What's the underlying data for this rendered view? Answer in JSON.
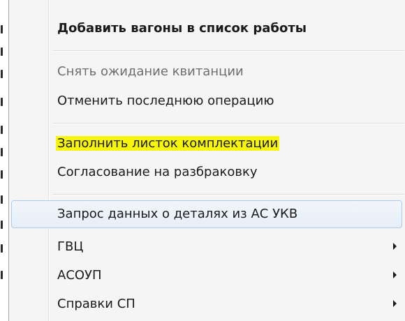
{
  "menu": {
    "items": [
      {
        "label": "Добавить вагоны в список работы",
        "bold": true,
        "enabled": true
      },
      {
        "label": "Снять ожидание квитанции",
        "enabled": false
      },
      {
        "label": "Отменить последнюю операцию",
        "enabled": true
      },
      {
        "label": "Заполнить листок комплектации",
        "enabled": true,
        "highlighted_color": "#f6f50a"
      },
      {
        "label": "Согласование на разбраковку",
        "enabled": true
      },
      {
        "label": "Запрос данных о деталях из АС УКВ",
        "enabled": true,
        "hovered": true
      },
      {
        "label": "ГВЦ",
        "enabled": true,
        "submenu": true,
        "icon": "chevron-right-icon"
      },
      {
        "label": "АСОУП",
        "enabled": true,
        "submenu": true,
        "icon": "chevron-right-icon"
      },
      {
        "label": "Справки СП",
        "enabled": true,
        "submenu": true,
        "icon": "chevron-right-icon"
      }
    ]
  },
  "colors": {
    "menu_background": "#f5f5f5",
    "hover_border": "#aecce9",
    "highlight": "#f6f50a",
    "disabled_text": "#6d6d6d"
  }
}
